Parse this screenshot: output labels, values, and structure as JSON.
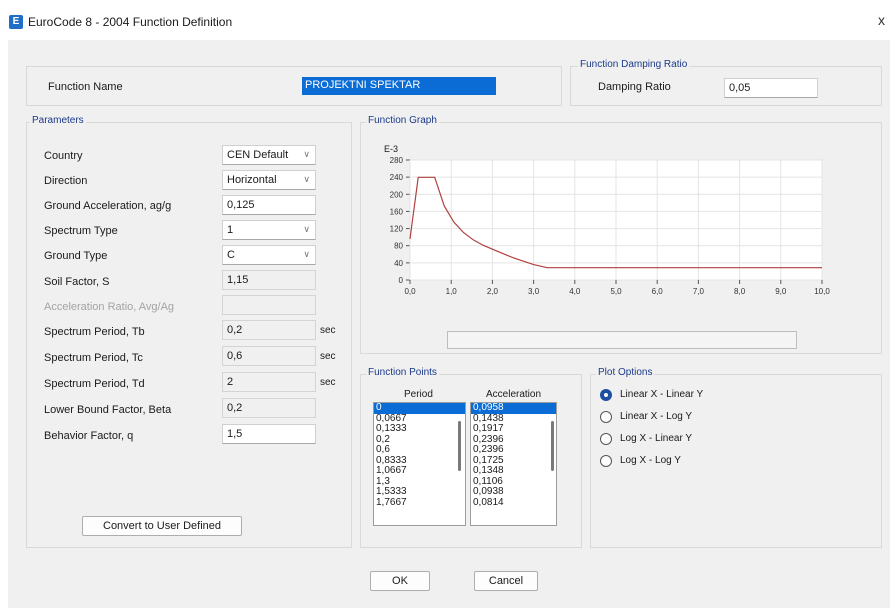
{
  "window": {
    "title": "EuroCode 8 - 2004 Function Definition",
    "icon_letter": "E",
    "close_glyph": "x"
  },
  "function_name": {
    "label": "Function Name",
    "value": "PROJEKTNI SPEKTAR"
  },
  "damping": {
    "group": "Function Damping Ratio",
    "label": "Damping Ratio",
    "value": "0,05"
  },
  "parameters": {
    "group": "Parameters",
    "country": {
      "label": "Country",
      "value": "CEN Default"
    },
    "direction": {
      "label": "Direction",
      "value": "Horizontal"
    },
    "ground_accel": {
      "label": "Ground Acceleration, ag/g",
      "value": "0,125"
    },
    "spectrum_type": {
      "label": "Spectrum Type",
      "value": "1"
    },
    "ground_type": {
      "label": "Ground Type",
      "value": "C"
    },
    "soil_factor": {
      "label": "Soil Factor, S",
      "value": "1,15"
    },
    "accel_ratio": {
      "label": "Acceleration Ratio, Avg/Ag",
      "value": ""
    },
    "tb": {
      "label": "Spectrum Period, Tb",
      "value": "0,2",
      "unit": "sec"
    },
    "tc": {
      "label": "Spectrum Period, Tc",
      "value": "0,6",
      "unit": "sec"
    },
    "td": {
      "label": "Spectrum Period, Td",
      "value": "2",
      "unit": "sec"
    },
    "beta": {
      "label": "Lower Bound Factor, Beta",
      "value": "0,2"
    },
    "q": {
      "label": "Behavior Factor, q",
      "value": "1,5"
    },
    "convert_button": "Convert to User Defined"
  },
  "graph": {
    "group": "Function Graph"
  },
  "chart_data": {
    "type": "line",
    "y_exponent_label": "E-3",
    "x": [
      0,
      0.0667,
      0.1333,
      0.2,
      0.6,
      0.8333,
      1.0667,
      1.3,
      1.5333,
      1.7667,
      2.0,
      2.5,
      3.0,
      3.33,
      4.0,
      5.0,
      6.0,
      7.0,
      8.0,
      9.0,
      10.0
    ],
    "y": [
      95.8,
      143.8,
      191.7,
      239.6,
      239.6,
      172.5,
      134.8,
      110.6,
      93.8,
      81.4,
      71.9,
      52.0,
      36.0,
      28.75,
      28.75,
      28.75,
      28.75,
      28.75,
      28.75,
      28.75,
      28.75
    ],
    "xlim": [
      0,
      10
    ],
    "ylim": [
      0,
      280
    ],
    "x_ticks": [
      "0,0",
      "1,0",
      "2,0",
      "3,0",
      "4,0",
      "5,0",
      "6,0",
      "7,0",
      "8,0",
      "9,0",
      "10,0"
    ],
    "y_ticks": [
      "0",
      "40",
      "80",
      "120",
      "160",
      "200",
      "240",
      "280"
    ],
    "grid": true,
    "line_color": "#b04040"
  },
  "points": {
    "group": "Function Points",
    "period_header": "Period",
    "accel_header": "Acceleration",
    "periods": [
      "0",
      "0,0667",
      "0,1333",
      "0,2",
      "0,6",
      "0,8333",
      "1,0667",
      "1,3",
      "1,5333",
      "1,7667"
    ],
    "accelerations": [
      "0,0958",
      "0,1438",
      "0,1917",
      "0,2396",
      "0,2396",
      "0,1725",
      "0,1348",
      "0,1106",
      "0,0938",
      "0,0814"
    ]
  },
  "plot_options": {
    "group": "Plot Options",
    "opt1": "Linear X - Linear Y",
    "opt2": "Linear X - Log Y",
    "opt3": "Log X - Linear Y",
    "opt4": "Log X - Log Y"
  },
  "buttons": {
    "ok": "OK",
    "cancel": "Cancel"
  },
  "colors": {
    "accent": "#1d4fa3",
    "selection": "#0b6cd6"
  }
}
